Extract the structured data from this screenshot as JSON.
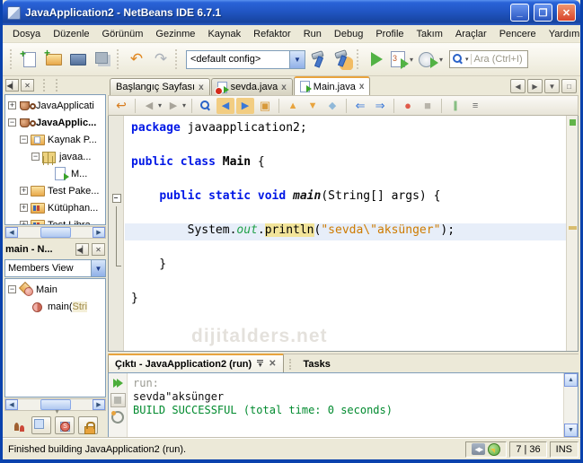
{
  "window": {
    "title": "JavaApplication2 - NetBeans IDE 6.7.1"
  },
  "window_controls": {
    "minimize": "_",
    "maximize": "❐",
    "close": "✕"
  },
  "menubar": {
    "items": [
      "Dosya",
      "Düzenle",
      "Görünüm",
      "Gezinme",
      "Kaynak",
      "Refaktor",
      "Run",
      "Debug",
      "Profile",
      "Takım",
      "Araçlar",
      "Pencere",
      "Yardım"
    ]
  },
  "toolbar": {
    "config_value": "<default config>",
    "search_placeholder": "Ara (Ctrl+I)",
    "file_icons": [
      {
        "name": "new-file-icon"
      },
      {
        "name": "new-project-icon"
      },
      {
        "name": "open-project-icon"
      },
      {
        "name": "save-all-icon"
      }
    ],
    "edit_icons": [
      {
        "name": "undo-icon",
        "glyph": "↶",
        "color": "#e0861e",
        "size": 17
      },
      {
        "name": "redo-icon",
        "glyph": "↷",
        "color": "#abb1b9",
        "size": 17
      }
    ],
    "build_icons": [
      {
        "name": "build-icon"
      },
      {
        "name": "clean-build-icon"
      }
    ],
    "run_icons": [
      {
        "name": "run-icon"
      }
    ],
    "dropdown_icons": [
      {
        "name": "debug-icon",
        "caret": true
      },
      {
        "name": "profile-icon",
        "caret": true
      }
    ]
  },
  "editor_toolbar": {
    "groups": [
      [
        {
          "name": "jump-last-edit-icon",
          "glyph": "↩",
          "color": "#d87c1e",
          "size": 14
        }
      ],
      [
        {
          "name": "back-icon",
          "glyph": "◀",
          "color": "#a8a49a",
          "caret": true
        },
        {
          "name": "forward-icon",
          "glyph": "▶",
          "color": "#a8a49a",
          "caret": true
        }
      ],
      [
        {
          "name": "find-selection-icon",
          "mag": true
        },
        {
          "name": "find-prev-icon",
          "glyph": "◀",
          "color": "#3a78d8",
          "bg": "#f2cd82"
        },
        {
          "name": "find-next-icon",
          "glyph": "▶",
          "color": "#3a78d8",
          "bg": "#f2cd82"
        },
        {
          "name": "toggle-highlight-icon",
          "glyph": "▣",
          "color": "#d89a3a",
          "size": 13
        }
      ],
      [
        {
          "name": "prev-bookmark-icon",
          "glyph": "▲",
          "color": "#e8a33d"
        },
        {
          "name": "next-bookmark-icon",
          "glyph": "▼",
          "color": "#e8a33d"
        },
        {
          "name": "toggle-bookmark-icon",
          "glyph": "◆",
          "color": "#90b8d8"
        }
      ],
      [
        {
          "name": "shift-left-icon",
          "glyph": "⇐",
          "color": "#3a78d8",
          "size": 13
        },
        {
          "name": "shift-right-icon",
          "glyph": "⇒",
          "color": "#3a78d8",
          "size": 13
        }
      ],
      [
        {
          "name": "record-macro-icon",
          "glyph": "●",
          "color": "#e05a4a",
          "size": 13
        },
        {
          "name": "stop-macro-icon",
          "glyph": "■",
          "color": "#b8b4aa",
          "size": 13
        }
      ],
      [
        {
          "name": "comment-icon",
          "glyph": "∥",
          "color": "#3a9a3a"
        },
        {
          "name": "uncomment-icon",
          "glyph": "≡",
          "color": "#6a6a6a"
        }
      ]
    ]
  },
  "projects": {
    "items": [
      {
        "label": "JavaApplicati",
        "exp": "+",
        "icon": "project-icon",
        "bold": false,
        "ind": 0
      },
      {
        "label": "JavaApplic...",
        "exp": "-",
        "icon": "project-icon",
        "bold": true,
        "ind": 0
      },
      {
        "label": "Kaynak P...",
        "exp": "-",
        "icon": "source-folder-icon",
        "bold": false,
        "ind": 1
      },
      {
        "label": "javaa...",
        "exp": "-",
        "icon": "package-icon",
        "bold": false,
        "ind": 2
      },
      {
        "label": "M...",
        "exp": "",
        "icon": "java-class-file-icon",
        "bold": false,
        "ind": 3
      },
      {
        "label": "Test Pake...",
        "exp": "+",
        "icon": "folder-icon",
        "bold": false,
        "ind": 1
      },
      {
        "label": "Kütüphan...",
        "exp": "+",
        "icon": "libraries-icon",
        "bold": false,
        "ind": 1
      },
      {
        "label": "Test Libra...",
        "exp": "+",
        "icon": "libraries-icon",
        "bold": false,
        "ind": 1
      }
    ]
  },
  "navigator": {
    "title": "main - N...",
    "view_select": "Members View",
    "items": [
      {
        "parts": [
          {
            "t": "Main",
            "c": "n"
          }
        ],
        "exp": "-",
        "icon": "class-icon",
        "ind": 0
      },
      {
        "parts": [
          {
            "t": "main(",
            "c": "n"
          },
          {
            "t": "Stri",
            "c": "type"
          }
        ],
        "exp": "",
        "icon": "method-icon",
        "ind": 1
      }
    ]
  },
  "editor": {
    "tabs": [
      {
        "label": "Başlangıç Sayfası",
        "close": "x"
      },
      {
        "label": "sevda.java",
        "close": "x"
      },
      {
        "label": "Main.java",
        "close": "x"
      }
    ],
    "watermark": "dijitalders.net",
    "code": [
      {
        "g": "",
        "tokens": [
          {
            "t": "package",
            "c": "kw"
          },
          {
            "t": " javaapplication2;",
            "c": "pl"
          }
        ]
      },
      {
        "g": "",
        "tokens": []
      },
      {
        "g": "",
        "tokens": [
          {
            "t": "public class",
            "c": "kw"
          },
          {
            "t": " ",
            "c": "pl"
          },
          {
            "t": "Main",
            "c": "cls"
          },
          {
            "t": " {",
            "c": "pl"
          }
        ]
      },
      {
        "g": "",
        "tokens": []
      },
      {
        "g": "start",
        "tokens": [
          {
            "t": "    ",
            "c": "pl"
          },
          {
            "t": "public static void",
            "c": "kw"
          },
          {
            "t": " ",
            "c": "pl"
          },
          {
            "t": "main",
            "c": "dec"
          },
          {
            "t": "(String[] args) {",
            "c": "pl"
          }
        ]
      },
      {
        "g": "line",
        "tokens": []
      },
      {
        "g": "line",
        "hl": true,
        "tokens": [
          {
            "t": "        System.",
            "c": "pl"
          },
          {
            "t": "out",
            "c": "fld"
          },
          {
            "t": ".",
            "c": "pl"
          },
          {
            "t": "println",
            "c": "occ"
          },
          {
            "t": "(",
            "c": "pl"
          },
          {
            "t": "\"sevda\\\"aksünger\"",
            "c": "str"
          },
          {
            "t": ");",
            "c": "pl"
          }
        ]
      },
      {
        "g": "line",
        "tokens": []
      },
      {
        "g": "end",
        "tokens": [
          {
            "t": "    }",
            "c": "pl"
          }
        ]
      },
      {
        "g": "",
        "tokens": []
      },
      {
        "g": "",
        "tokens": [
          {
            "t": "}",
            "c": "pl"
          }
        ]
      }
    ]
  },
  "output": {
    "tabs": [
      {
        "label": "Çıktı - JavaApplication2 (run)"
      },
      {
        "label": "Tasks"
      }
    ],
    "lines": [
      {
        "text": "run:",
        "c": "gray"
      },
      {
        "text": "sevda\"aksünger",
        "c": "black"
      },
      {
        "text": "BUILD SUCCESSFUL (total time: 0 seconds)",
        "c": "green"
      }
    ]
  },
  "statusbar": {
    "message": "Finished building JavaApplication2 (run).",
    "position": "7 | 36",
    "mode": "INS"
  }
}
